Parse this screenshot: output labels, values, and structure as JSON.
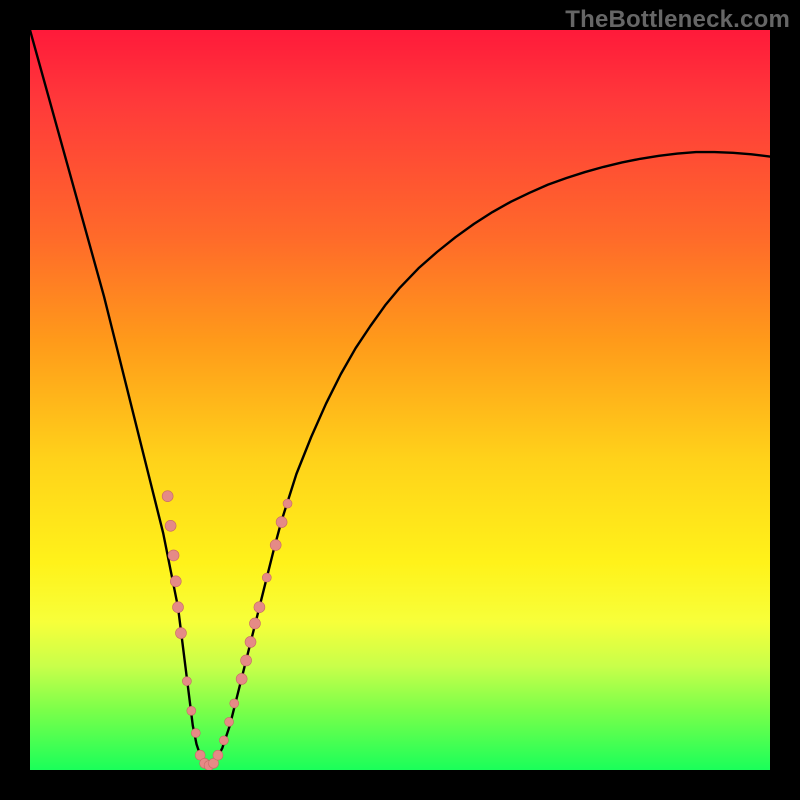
{
  "watermark": "TheBottleneck.com",
  "colors": {
    "frame": "#000000",
    "curve": "#000000",
    "marker_fill": "#e58a86",
    "marker_stroke": "#c86a66"
  },
  "chart_data": {
    "type": "line",
    "title": "",
    "xlabel": "",
    "ylabel": "",
    "xlim": [
      0,
      100
    ],
    "ylim": [
      0,
      100
    ],
    "grid": false,
    "legend": false,
    "x": [
      0,
      2.5,
      5,
      7.5,
      10,
      11,
      12,
      13,
      14,
      15,
      16,
      17,
      18,
      19,
      20,
      20.5,
      21,
      21.5,
      22,
      22.5,
      23,
      23.5,
      24,
      24.5,
      25,
      26,
      27,
      28,
      29,
      30,
      31,
      32,
      33,
      34,
      36,
      38,
      40,
      42,
      44,
      46,
      48,
      50,
      52.5,
      55,
      57.5,
      60,
      62.5,
      65,
      67.5,
      70,
      72.5,
      75,
      77.5,
      80,
      82.5,
      85,
      87.5,
      90,
      92.5,
      95,
      97.5,
      100
    ],
    "y": [
      100,
      91,
      82,
      73,
      64,
      60,
      56,
      52,
      48,
      44,
      40,
      36,
      32,
      27,
      22,
      18,
      14,
      10,
      6,
      3.5,
      2,
      1,
      0.5,
      0.5,
      1,
      3,
      6,
      10,
      14,
      18,
      22,
      26,
      30,
      33.7,
      40,
      45,
      49.5,
      53.5,
      57,
      60,
      62.8,
      65.2,
      67.8,
      70,
      72,
      73.8,
      75.4,
      76.8,
      78,
      79.1,
      80,
      80.8,
      81.5,
      82.1,
      82.6,
      83,
      83.3,
      83.5,
      83.5,
      83.4,
      83.2,
      82.9
    ],
    "marker_clusters": [
      {
        "x": 18.6,
        "y": 37,
        "r": 5.5
      },
      {
        "x": 19.0,
        "y": 33,
        "r": 5.5
      },
      {
        "x": 19.4,
        "y": 29,
        "r": 5.5
      },
      {
        "x": 19.7,
        "y": 25.5,
        "r": 5.5
      },
      {
        "x": 20.0,
        "y": 22,
        "r": 5.5
      },
      {
        "x": 20.4,
        "y": 18.5,
        "r": 5.5
      },
      {
        "x": 21.2,
        "y": 12,
        "r": 4.5
      },
      {
        "x": 21.8,
        "y": 8,
        "r": 4.5
      },
      {
        "x": 22.4,
        "y": 5,
        "r": 4.5
      },
      {
        "x": 23.0,
        "y": 2.0,
        "r": 5.0
      },
      {
        "x": 23.6,
        "y": 0.9,
        "r": 5.0
      },
      {
        "x": 24.2,
        "y": 0.6,
        "r": 5.0
      },
      {
        "x": 24.8,
        "y": 0.9,
        "r": 5.0
      },
      {
        "x": 25.4,
        "y": 2.0,
        "r": 5.0
      },
      {
        "x": 26.2,
        "y": 4.0,
        "r": 4.5
      },
      {
        "x": 26.9,
        "y": 6.5,
        "r": 4.5
      },
      {
        "x": 27.6,
        "y": 9.0,
        "r": 4.5
      },
      {
        "x": 28.6,
        "y": 12.3,
        "r": 5.5
      },
      {
        "x": 29.2,
        "y": 14.8,
        "r": 5.5
      },
      {
        "x": 29.8,
        "y": 17.3,
        "r": 5.5
      },
      {
        "x": 30.4,
        "y": 19.8,
        "r": 5.5
      },
      {
        "x": 31.0,
        "y": 22.0,
        "r": 5.5
      },
      {
        "x": 32.0,
        "y": 26.0,
        "r": 4.5
      },
      {
        "x": 33.2,
        "y": 30.4,
        "r": 5.5
      },
      {
        "x": 34.0,
        "y": 33.5,
        "r": 5.5
      },
      {
        "x": 34.8,
        "y": 36.0,
        "r": 4.5
      }
    ]
  }
}
